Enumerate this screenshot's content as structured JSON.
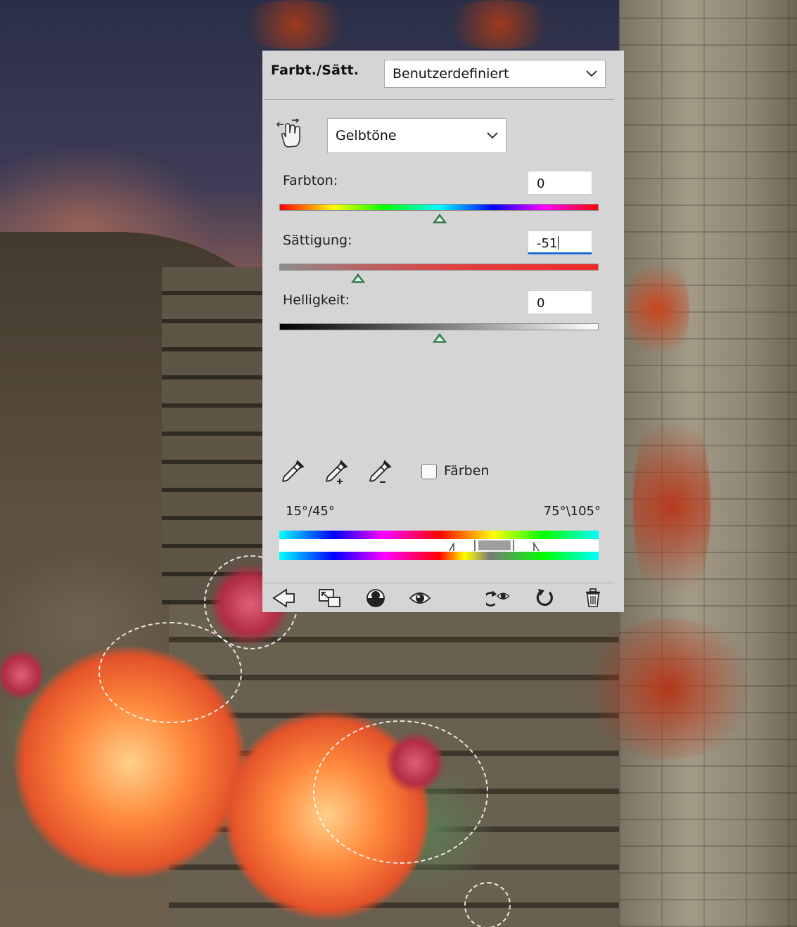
{
  "panel": {
    "title": "Farbt./Sätt.",
    "preset": {
      "selected": "Benutzerdefiniert"
    },
    "channel": {
      "selected": "Gelbtöne"
    },
    "sliders": {
      "hue": {
        "label": "Farbton:",
        "value": "0"
      },
      "saturation": {
        "label": "Sättigung:",
        "value": "-51"
      },
      "lightness": {
        "label": "Helligkeit:",
        "value": "0"
      }
    },
    "colorize": {
      "label": "Färben",
      "checked": false
    },
    "range": {
      "left": "15°/45°",
      "right": "75°\\105°"
    }
  },
  "icons": {
    "targeted_adjustment": "hand-scrubby-icon",
    "eyedroppers": [
      "eyedropper-icon",
      "eyedropper-add-icon",
      "eyedropper-subtract-icon"
    ],
    "footer": [
      "clip-to-layer-icon",
      "expand-view-icon",
      "layer-mask-icon",
      "visibility-eye-icon",
      "view-previous-state-icon",
      "reset-icon",
      "trash-icon"
    ]
  },
  "colors": {
    "panel_bg": "#d5d5d5",
    "focus_underline": "#1a6fd6",
    "thumb_green": "#3c9a5c"
  }
}
